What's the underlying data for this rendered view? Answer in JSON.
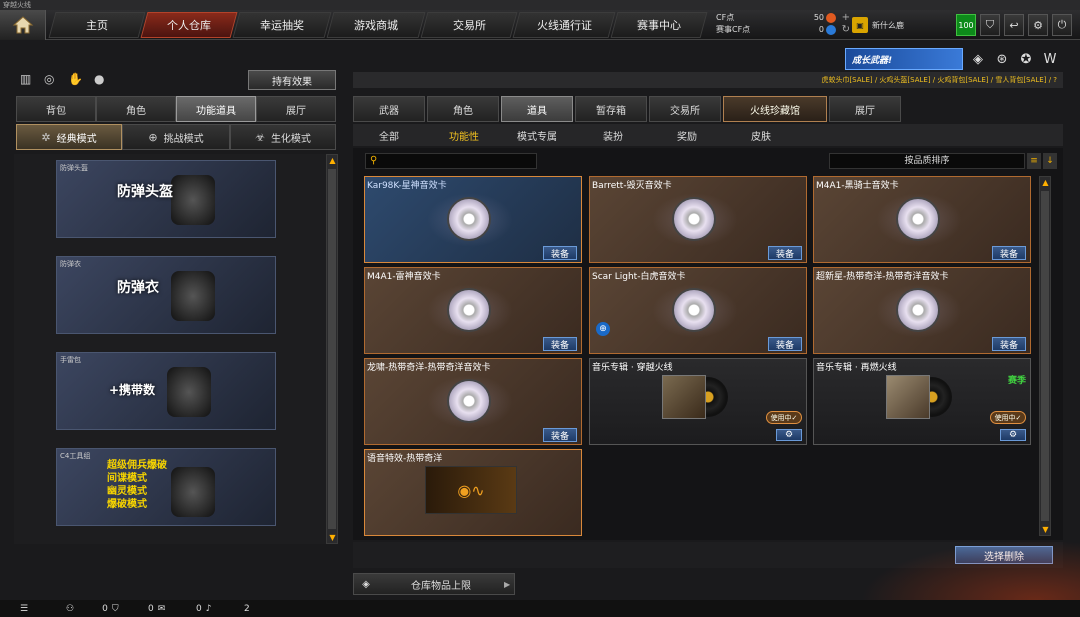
{
  "window": {
    "title": "穿越火线"
  },
  "topnav": {
    "tabs": [
      "主页",
      "个人仓库",
      "幸运抽奖",
      "游戏商城",
      "交易所",
      "火线通行证",
      "赛事中心"
    ],
    "active": 1
  },
  "currency": {
    "cf_label": "CF点",
    "cf_value": "50",
    "event_label": "赛事CF点",
    "event_value": "0",
    "news_label": "新什么鹿",
    "level": "100"
  },
  "left": {
    "effect_button": "持有效果",
    "tabs": [
      "背包",
      "角色",
      "功能道具",
      "展厅"
    ],
    "active_tab": 2,
    "modes": [
      "经典模式",
      "挑战模式",
      "生化模式"
    ],
    "active_mode": 0,
    "items": [
      {
        "title": "防弹头盔",
        "art": "防弹头盔"
      },
      {
        "title": "防弹衣",
        "art": "防弹衣"
      },
      {
        "title": "手雷包",
        "art": "+携带数"
      },
      {
        "title": "C4工具组",
        "art_lines": [
          "超级佣兵爆破",
          "间谍模式",
          "幽灵模式",
          "爆破模式"
        ]
      }
    ]
  },
  "right": {
    "banner": "成长武器!",
    "ticker": "虎蛟头巾[SALE] / 火鸡头盔[SALE] / 火鸡背包[SALE] / 雪人背包[SALE] / ?",
    "tabs": [
      "武器",
      "角色",
      "道具",
      "暂存箱",
      "交易所",
      "火线珍藏馆",
      "展厅"
    ],
    "active_tab": 2,
    "subtabs": [
      "全部",
      "功能性",
      "模式专属",
      "装扮",
      "奖励",
      "皮肤"
    ],
    "active_subtab": 1,
    "search_placeholder": "",
    "sort_label": "按品质排序",
    "cards": [
      {
        "name": "Kar98K-星神音效卡",
        "button": "装备",
        "kind": "disc",
        "selected": true
      },
      {
        "name": "Barrett-毁灭音效卡",
        "button": "装备",
        "kind": "disc"
      },
      {
        "name": "M4A1-黑骑士音效卡",
        "button": "装备",
        "kind": "disc"
      },
      {
        "name": "M4A1-雷神音效卡",
        "button": "装备",
        "kind": "disc"
      },
      {
        "name": "Scar Light-白虎音效卡",
        "button": "装备",
        "kind": "disc"
      },
      {
        "name": "超新星-热带奇洋-热带奇洋音效卡",
        "button": "装备",
        "kind": "disc"
      },
      {
        "name": "龙啸-热带奇洋-热带奇洋音效卡",
        "button": "装备",
        "kind": "disc"
      },
      {
        "name": "音乐专辑 · 穿越火线",
        "in_use": "使用中✓",
        "kind": "album"
      },
      {
        "name": "音乐专辑 · 再燃火线",
        "in_use": "使用中✓",
        "season": "赛季",
        "kind": "album"
      },
      {
        "name": "语音特效-热带奇洋",
        "kind": "voice"
      }
    ],
    "delete_button": "选择删除",
    "limit_label": "仓库物品上限"
  },
  "status": {
    "a": "0",
    "b": "0",
    "c": "0",
    "d": "2"
  },
  "colors": {
    "accent": "#d9883a",
    "equip": "#3a5a8a",
    "active_tab": "#8a2a1a"
  }
}
